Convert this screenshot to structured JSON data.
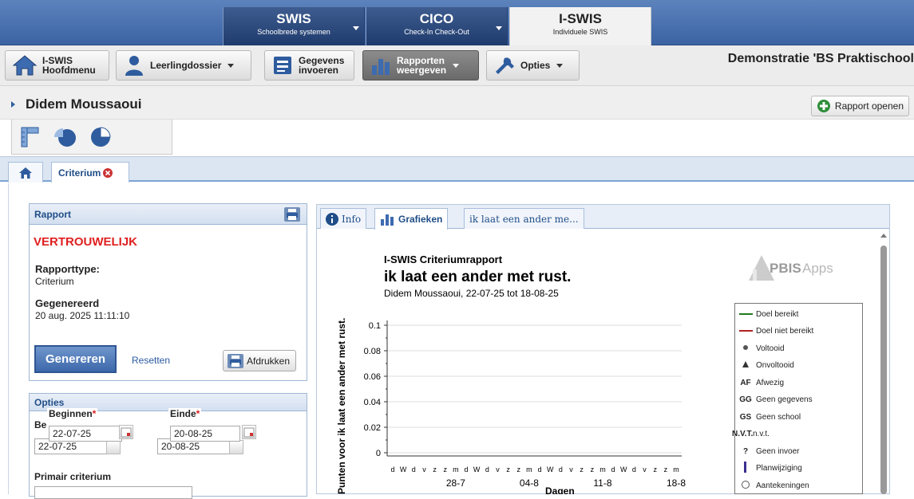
{
  "top_tabs": [
    {
      "title": "SWIS",
      "subtitle": "Schoolbrede systemen"
    },
    {
      "title": "CICO",
      "subtitle": "Check-In Check-Out"
    },
    {
      "title": "I-SWIS",
      "subtitle": "Individuele SWIS"
    }
  ],
  "toolbar": {
    "home_line1": "I-SWIS",
    "home_line2": "Hoofdmenu",
    "student_file": "Leerlingdossier",
    "enter_line1": "Gegevens",
    "enter_line2": "invoeren",
    "reports_line1": "Rapporten",
    "reports_line2": "weergeven",
    "options": "Opties",
    "school_name": "Demonstratie 'BS Praktischool"
  },
  "student": {
    "name": "Didem Moussaoui"
  },
  "open_report_button": "Rapport openen",
  "tabs": {
    "criterium": "Criterium"
  },
  "rapport_panel": {
    "title": "Rapport",
    "confidential": "VERTROUWELIJK",
    "type_label": "Rapporttype:",
    "type_value": "Criterium",
    "generated_label": "Gegenereerd",
    "generated_value": "20 aug. 2025 11:11:10",
    "generate_button": "Genereren",
    "reset_link": "Resetten",
    "print_button": "Afdrukken"
  },
  "options_panel": {
    "title": "Opties",
    "begin_label": "Beginnen",
    "end_label": "Einde",
    "required_mark": "*",
    "begin_value": "22-07-25",
    "end_value": "20-08-25",
    "begin_short": "Be",
    "primary_criterion": "Primair criterium"
  },
  "graph_tabs": {
    "info": "Info",
    "graphs": "Grafieken",
    "other": "ik laat een ander me..."
  },
  "chart_data": {
    "type": "line",
    "title": "I-SWIS Criteriumrapport",
    "subtitle": "ik laat een ander met rust.",
    "caption": "Didem Moussaoui, 22-07-25 tot 18-08-25",
    "ylabel": "Punten voor ik laat een ander met rust.",
    "xlabel": "Dagen",
    "yticks": [
      "0",
      "0.02",
      "0.04",
      "0.06",
      "0.08",
      "0.1"
    ],
    "ylim": [
      0,
      0.1
    ],
    "day_letters": [
      "d",
      "W",
      "d",
      "v",
      "z",
      "z",
      "m",
      "d",
      "W",
      "d",
      "v",
      "z",
      "z",
      "m",
      "d",
      "W",
      "d",
      "v",
      "z",
      "z",
      "m",
      "d",
      "W",
      "d",
      "v",
      "z",
      "z",
      "m"
    ],
    "week_labels": [
      "28-7",
      "04-8",
      "11-8",
      "18-8"
    ],
    "series": []
  },
  "brand": {
    "part1": "PBIS",
    "part2": "Apps"
  },
  "legend": [
    {
      "symbol": "line-green",
      "label": "Doel bereikt"
    },
    {
      "symbol": "line-red",
      "label": "Doel niet bereikt"
    },
    {
      "symbol": "dot",
      "label": "Voltooid"
    },
    {
      "symbol": "triangle",
      "label": "Onvoltooid"
    },
    {
      "symbol": "AF",
      "label": "Afwezig"
    },
    {
      "symbol": "GG",
      "label": "Geen gegevens"
    },
    {
      "symbol": "GS",
      "label": "Geen school"
    },
    {
      "symbol": "N.V.T.",
      "label": "n.v.t."
    },
    {
      "symbol": "?",
      "label": "Geen invoer"
    },
    {
      "symbol": "bar",
      "label": "Planwijziging"
    },
    {
      "symbol": "circle",
      "label": "Aantekeningen"
    }
  ],
  "colors": {
    "goal_met": "#1f7a1f",
    "goal_not_met": "#b22222",
    "confidential": "#e02020",
    "header_blue": "#3b63a3"
  }
}
